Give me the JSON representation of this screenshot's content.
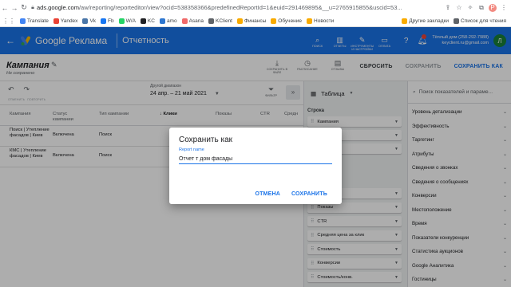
{
  "browser": {
    "url_host": "ads.google.com",
    "url_path": "/aw/reporting/reporteditor/view?ocid=538358366&predefinedReportId=1&euid=291469895&__u=2765915855&uscid=53...",
    "profile_badge": "P"
  },
  "bookmarks": [
    {
      "label": "Translate",
      "color": "#4285f4"
    },
    {
      "label": "Yandex",
      "color": "#ea4335"
    },
    {
      "label": "Vk",
      "color": "#4a76a8"
    },
    {
      "label": "Fb",
      "color": "#1877f2"
    },
    {
      "label": "W/A",
      "color": "#25d366"
    },
    {
      "label": "KC",
      "color": "#202124"
    },
    {
      "label": "amo",
      "color": "#2e77d0"
    },
    {
      "label": "Asana",
      "color": "#f06a6a"
    },
    {
      "label": "KClient",
      "color": "#5f6368"
    },
    {
      "label": "Финансы",
      "color": "#f9ab00"
    },
    {
      "label": "Обучение",
      "color": "#f9ab00"
    },
    {
      "label": "Новости",
      "color": "#f9ab00"
    }
  ],
  "bookmarks_right": [
    {
      "label": "Другие закладки",
      "color": "#f9ab00"
    },
    {
      "label": "Список для чтения",
      "color": "#5f6368"
    }
  ],
  "header": {
    "logo_text": "Google Реклама",
    "section": "Отчетность",
    "tools": [
      {
        "icon": "search-icon",
        "label": "ПОИСК"
      },
      {
        "icon": "reports-icon",
        "label": "ОТЧЕТЫ"
      },
      {
        "icon": "tools-icon",
        "label": "ИНСТРУМЕНТЫ И НАСТРОЙКИ"
      },
      {
        "icon": "billing-icon",
        "label": "ОПЛАТА"
      }
    ],
    "account_name": "Тёплый дом (258-292-7988)",
    "account_email": "keyclient.ru@gmail.com",
    "avatar_letter": "Л"
  },
  "titlebar": {
    "campaign": "Кампания",
    "status": "Не сохранено",
    "tools": [
      {
        "icon": "download-icon",
        "label": "СОХРАНИТЬ В ФАЙЛ"
      },
      {
        "icon": "schedule-icon",
        "label": "РАСПИСАНИЕ"
      },
      {
        "icon": "feedback-icon",
        "label": "ОТЗЫВЫ"
      }
    ],
    "reset": "СБРОСИТЬ",
    "save": "СОХРАНИТЬ",
    "save_as": "СОХРАНИТЬ КАК"
  },
  "toolrow": {
    "undo": "ОТМЕНИТЬ",
    "redo": "ПОВТОРИТЬ",
    "range_label": "Другой диапазон",
    "range_value": "24 апр. – 21 май 2021",
    "filter": "ФИЛЬТР"
  },
  "table": {
    "columns": [
      "Кампания",
      "Статус кампании",
      "Тип кампании",
      "Клики",
      "Показы",
      "CTR",
      "Средн"
    ],
    "sorted_column": "Клики",
    "rows": [
      {
        "campaign": "Поиск | Утепление фасадов | Киев",
        "status": "Включена",
        "type": "Поиск"
      },
      {
        "campaign": "КМС | Утепление фасадов | Киев",
        "status": "Включена",
        "type": "Поиск"
      }
    ]
  },
  "midpanel": {
    "title": "Таблица",
    "row_section": "Строка",
    "row_chips": [
      "Кампания",
      "",
      ""
    ],
    "metric_chips": [
      "",
      "Показы",
      "CTR",
      "Средняя цена за клик",
      "Стоимость",
      "Конверсии",
      "Стоимость/конв."
    ]
  },
  "rightpanel": {
    "search_placeholder": "Поиск показателей и параме...",
    "categories": [
      "Уровень детализации",
      "Эффективность",
      "Таргетинг",
      "Атрибуты",
      "Сведения о звонках",
      "Сведения о сообщениях",
      "Конверсии",
      "Местоположение",
      "Время",
      "Показатели конкуренции",
      "Статистика аукционов",
      "Google Аналитика",
      "Гостиницы",
      "Атрибуты из Google Покупок"
    ]
  },
  "dialog": {
    "title": "Сохранить как",
    "field_label": "Report name",
    "field_value": "Отчет т дом фасады",
    "cancel": "ОТМЕНА",
    "save": "СОХРАНИТЬ"
  }
}
